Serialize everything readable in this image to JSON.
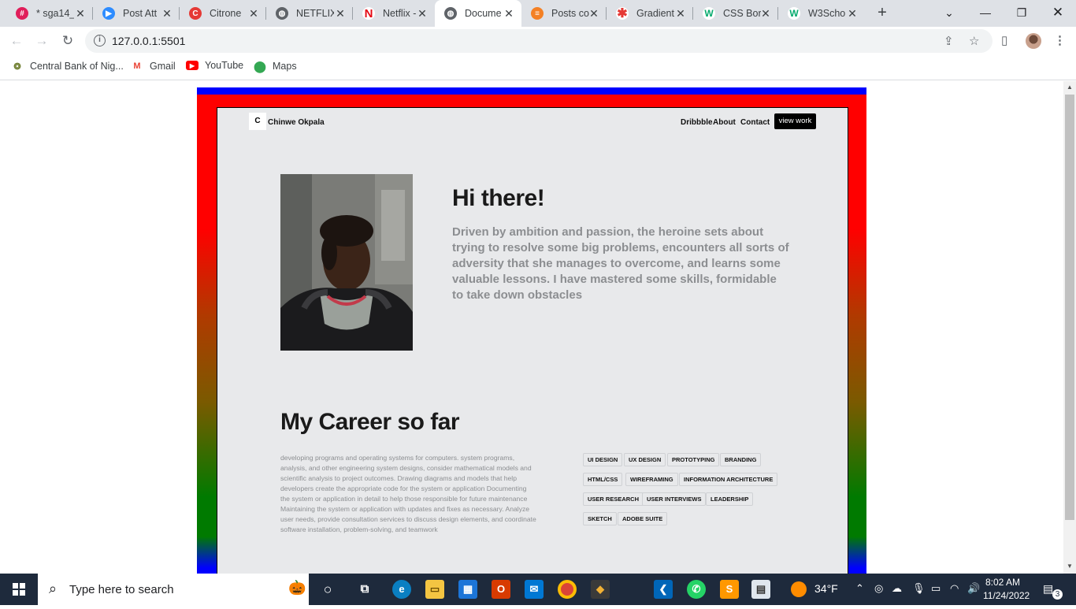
{
  "browser": {
    "tabs": [
      {
        "title": "* sga14_",
        "icon": "slack-icon",
        "color": "#e01e5a"
      },
      {
        "title": "Post Att",
        "icon": "zoom-icon",
        "color": "#2d8cff"
      },
      {
        "title": "Citrone",
        "icon": "citrone-icon",
        "color": "#e53935"
      },
      {
        "title": "NETFLIX",
        "icon": "globe-icon",
        "color": "#5f6368"
      },
      {
        "title": "Netflix -",
        "icon": "netflix-icon",
        "color": "#e50914"
      },
      {
        "title": "Docume",
        "icon": "globe-icon",
        "color": "#5f6368"
      },
      {
        "title": "Posts co",
        "icon": "stack-icon",
        "color": "#f48024"
      },
      {
        "title": "Gradient",
        "icon": "asterisk-icon",
        "color": "#e53935"
      },
      {
        "title": "CSS Bor",
        "icon": "w3-icon",
        "color": "#04aa6d"
      },
      {
        "title": "W3Scho",
        "icon": "w3-icon",
        "color": "#04aa6d"
      }
    ],
    "active_tab_index": 5,
    "url": "127.0.0.1:5501",
    "bookmarks": [
      {
        "label": "Central Bank of Nig...",
        "icon": "cbn-icon"
      },
      {
        "label": "Gmail",
        "icon": "gmail-icon"
      },
      {
        "label": "YouTube",
        "icon": "youtube-icon"
      },
      {
        "label": "Maps",
        "icon": "maps-icon"
      }
    ]
  },
  "site": {
    "brand": "Chinwe Okpala",
    "nav": [
      "Dribbble",
      "About",
      "Contact"
    ],
    "cta": "view work",
    "hero_title": "Hi there!",
    "hero_text": "Driven by ambition and passion, the heroine sets about trying to resolve some big problems, encounters all sorts of adversity that she manages to overcome, and learns some valuable lessons. I have mastered some skills, formidable to take down obstacles",
    "career_title": "My Career so far",
    "career_text": "developing programs and operating systems for computers. system programs, analysis, and other engineering system designs, consider mathematical models and scientific analysis to project outcomes. Drawing diagrams and models that help developers create the appropriate code for the system or application Documenting the system or application in detail to help those responsible for future maintenance Maintaining the system or application with updates and fixes as necessary. Analyze user needs, provide consultation services to discuss design elements, and coordinate software installation, problem-solving, and teamwork",
    "skills": [
      "UI DESIGN",
      "UX DESIGN",
      "PROTOTYPING",
      "BRANDING",
      "HTML/CSS",
      "WIREFRAMING",
      "INFORMATION ARCHITECTURE",
      "USER RESEARCH",
      "USER INTERVIEWS",
      "LEADERSHIP",
      "SKETCH",
      "ADOBE SUITE"
    ]
  },
  "taskbar": {
    "search_placeholder": "Type here to search",
    "weather": "34°F",
    "time": "8:02 AM",
    "date": "11/24/2022",
    "notifications": "3"
  }
}
